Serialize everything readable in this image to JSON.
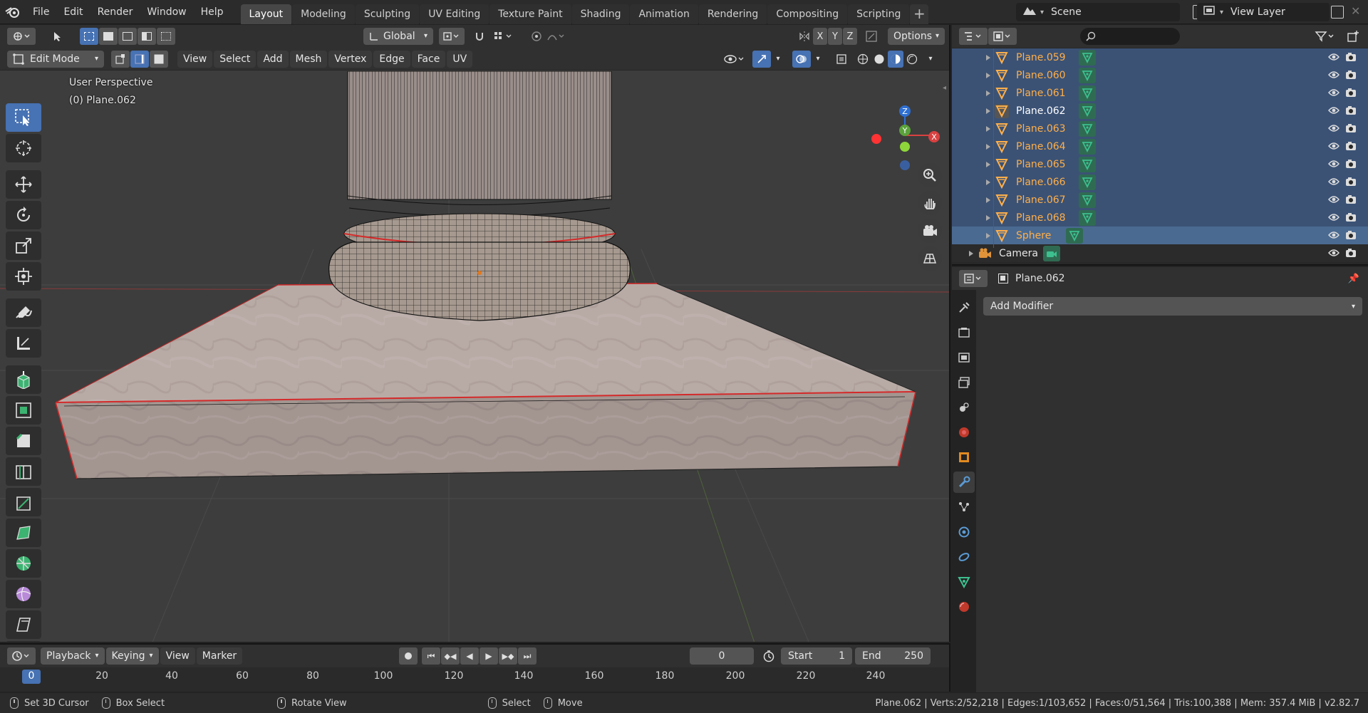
{
  "topbar": {
    "menus": [
      "File",
      "Edit",
      "Render",
      "Window",
      "Help"
    ],
    "workspaces": [
      "Layout",
      "Modeling",
      "Sculpting",
      "UV Editing",
      "Texture Paint",
      "Shading",
      "Animation",
      "Rendering",
      "Compositing",
      "Scripting"
    ],
    "active_workspace": "Layout",
    "add_workspace": "+",
    "scene": "Scene",
    "view_layer": "View Layer"
  },
  "viewport": {
    "transform_orientation": "Global",
    "options_label": "Options",
    "axes": [
      "X",
      "Y",
      "Z"
    ],
    "mode": "Edit Mode",
    "menus": [
      "View",
      "Select",
      "Add",
      "Mesh",
      "Vertex",
      "Edge",
      "Face",
      "UV"
    ],
    "perspective_label": "User Perspective",
    "object_label": "(0) Plane.062",
    "gizmo": {
      "x": "X",
      "y": "Y",
      "z": "Z"
    }
  },
  "timeline": {
    "menus": [
      "Playback",
      "Keying",
      "View",
      "Marker"
    ],
    "current_frame": "0",
    "start_label": "Start",
    "start_value": "1",
    "end_label": "End",
    "end_value": "250",
    "ticks": [
      "0",
      "20",
      "40",
      "60",
      "80",
      "100",
      "120",
      "140",
      "160",
      "180",
      "200",
      "220",
      "240"
    ]
  },
  "statusbar": {
    "items": [
      "Set 3D Cursor",
      "Box Select",
      "Rotate View",
      "Select",
      "Move"
    ],
    "stats": "Plane.062 | Verts:2/52,218 | Edges:1/103,652 | Faces:0/51,564 | Tris:100,388 | Mem: 357.4 MiB | v2.82.7"
  },
  "outliner": {
    "rows": [
      {
        "label": "Plane.059",
        "state": "sel"
      },
      {
        "label": "Plane.060",
        "state": "sel"
      },
      {
        "label": "Plane.061",
        "state": "sel"
      },
      {
        "label": "Plane.062",
        "state": "active"
      },
      {
        "label": "Plane.063",
        "state": "sel"
      },
      {
        "label": "Plane.064",
        "state": "sel"
      },
      {
        "label": "Plane.065",
        "state": "sel"
      },
      {
        "label": "Plane.066",
        "state": "sel"
      },
      {
        "label": "Plane.067",
        "state": "sel"
      },
      {
        "label": "Plane.068",
        "state": "sel"
      },
      {
        "label": "Sphere",
        "state": "sel-light"
      },
      {
        "label": "Camera",
        "state": "plain"
      }
    ]
  },
  "properties": {
    "object_name": "Plane.062",
    "add_modifier_label": "Add Modifier"
  },
  "colors": {
    "accent": "#4772b3",
    "selected_row": "#3b5275",
    "object_orange": "#ffaf4a",
    "mesh_green": "#3dbf8f",
    "edge_red": "#d42a2a"
  }
}
